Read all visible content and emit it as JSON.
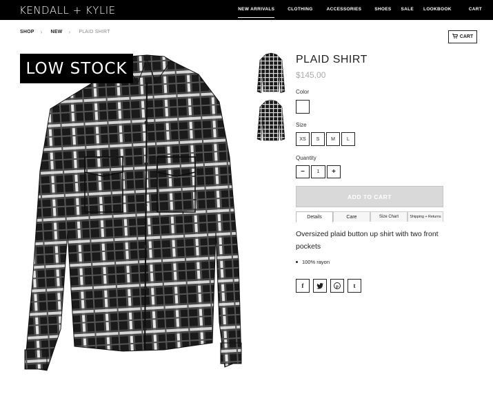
{
  "brand": {
    "logo": "KENDALL + KYLIE"
  },
  "nav": {
    "items": [
      "NEW ARRIVALS",
      "CLOTHING",
      "ACCESSORIES",
      "SHOES",
      "SALE",
      "LOOKBOOK",
      "CART"
    ]
  },
  "breadcrumb": {
    "items": [
      "SHOP",
      "NEW",
      "PLAID SHIRT"
    ]
  },
  "cart_button": {
    "label": "CART",
    "icon": "cart-icon"
  },
  "badge": {
    "text": "LOW STOCK"
  },
  "product": {
    "title": "PLAID SHIRT",
    "price": "$145.00",
    "color_label": "Color",
    "size_label": "Size",
    "sizes": [
      "XS",
      "S",
      "M",
      "L"
    ],
    "quantity_label": "Quantity",
    "quantity": "1",
    "add_to_cart": "ADD TO CART",
    "tabs": [
      "Details",
      "Care",
      "Size Chart",
      "Shipping + Returns"
    ],
    "description": "Oversized plaid button up shirt with two front pockets",
    "details": [
      "100% rayon"
    ]
  },
  "social": [
    "facebook-icon",
    "twitter-icon",
    "pinterest-icon",
    "tumblr-icon"
  ],
  "colors": {
    "topbar": "#000000",
    "price": "#aaaaaa",
    "add_to_cart_bg": "#d9d9d9"
  }
}
